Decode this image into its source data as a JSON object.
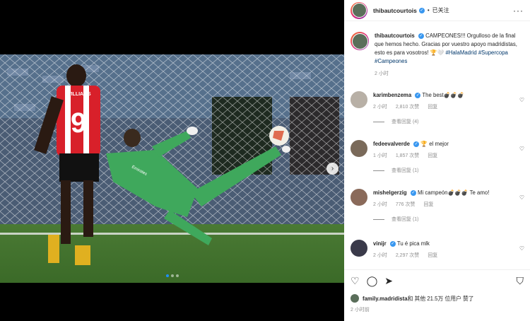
{
  "header": {
    "username": "thibautcourtois",
    "separator": "•",
    "follow_label": "已关注",
    "more": "···"
  },
  "caption": {
    "username": "thibautcourtois",
    "text": "CAMPEONES!!! Orgulloso de la final que hemos hecho. Gracias por vuestro apoyo madridistas, esto es para vosotros! 🏆🤍",
    "hashtags": "#HalaMadrid #Supercopa #Campeones",
    "time": "2 小时"
  },
  "comments": [
    {
      "username": "karimbenzema",
      "text": "The best💣💣💣",
      "time": "2 小时",
      "likes": "2,810 次赞",
      "reply_label": "回复",
      "replies": "查看回复 (4)"
    },
    {
      "username": "fedeevalverde",
      "text": "🏆 el mejor",
      "time": "1 小时",
      "likes": "1,857 次赞",
      "reply_label": "回复",
      "replies": "查看回复 (1)"
    },
    {
      "username": "mishelgerzig",
      "text": "Mi campeón💣💣💣 Te amo!",
      "time": "2 小时",
      "likes": "776 次赞",
      "reply_label": "回复",
      "replies": "查看回复 (1)"
    },
    {
      "username": "vinijr",
      "text": "Tu é pica mlk",
      "time": "2 小时",
      "likes": "2,297 次赞",
      "reply_label": "回复",
      "replies": ""
    }
  ],
  "likes_line": {
    "user": "family.madridista",
    "text": " 和 其他 21.5万 位用户 赞了"
  },
  "post_time": "2 小时前",
  "photo": {
    "shirt_text": "WILLIAMS",
    "shirt_number": "9",
    "keeper_text": "Emirates"
  },
  "carousel": {
    "count": 3,
    "active": 0
  },
  "colors": {
    "accent": "#3897f0",
    "dot_active": "#1e90ff"
  }
}
